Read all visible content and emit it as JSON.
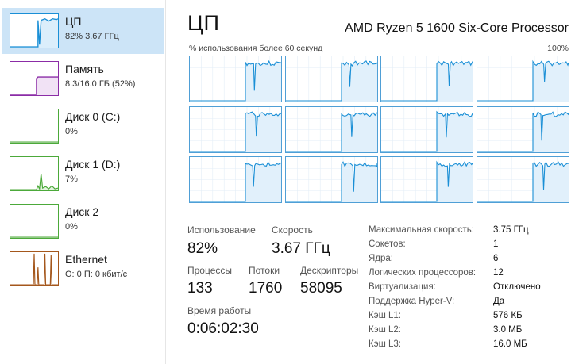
{
  "sidebar": {
    "items": [
      {
        "title": "ЦП",
        "subtitle": "82%  3.67 ГГц",
        "color": "#1a8fd6",
        "icon": "cpu-usage-graph",
        "selected": true
      },
      {
        "title": "Память",
        "subtitle": "8.3/16.0 ГБ (52%)",
        "color": "#8b2ca6",
        "icon": "memory-usage-graph",
        "selected": false
      },
      {
        "title": "Диск 0 (C:)",
        "subtitle": "0%",
        "color": "#4ca93a",
        "icon": "disk-activity-graph",
        "selected": false
      },
      {
        "title": "Диск 1 (D:)",
        "subtitle": "7%",
        "color": "#4ca93a",
        "icon": "disk-activity-graph",
        "selected": false
      },
      {
        "title": "Диск 2",
        "subtitle": "0%",
        "color": "#4ca93a",
        "icon": "disk-activity-graph",
        "selected": false
      },
      {
        "title": "Ethernet",
        "subtitle": "О: 0 П: 0 кбит/с",
        "color": "#a4571c",
        "icon": "network-throughput-graph",
        "selected": false
      }
    ]
  },
  "main": {
    "title": "ЦП",
    "cpu_model": "AMD Ryzen 5 1600 Six-Core Processor",
    "graph_caption": "% использования более 60 секунд",
    "graph_max": "100%",
    "core_count": 12,
    "accent": "#1a8fd6"
  },
  "stats": {
    "usage_label": "Использование",
    "usage_value": "82%",
    "speed_label": "Скорость",
    "speed_value": "3.67 ГГц",
    "processes_label": "Процессы",
    "processes_value": "133",
    "threads_label": "Потоки",
    "threads_value": "1760",
    "handles_label": "Дескрипторы",
    "handles_value": "58095",
    "uptime_label": "Время работы",
    "uptime_value": "0:06:02:30"
  },
  "specs": [
    {
      "label": "Максимальная скорость:",
      "value": "3.75 ГГц"
    },
    {
      "label": "Сокетов:",
      "value": "1"
    },
    {
      "label": "Ядра:",
      "value": "6"
    },
    {
      "label": "Логических процессоров:",
      "value": "12"
    },
    {
      "label": "Виртуализация:",
      "value": "Отключено"
    },
    {
      "label": "Поддержка Hyper-V:",
      "value": "Да"
    },
    {
      "label": "Кэш L1:",
      "value": "576 КБ"
    },
    {
      "label": "Кэш L2:",
      "value": "3.0 МБ"
    },
    {
      "label": "Кэш L3:",
      "value": "16.0 МБ"
    }
  ]
}
